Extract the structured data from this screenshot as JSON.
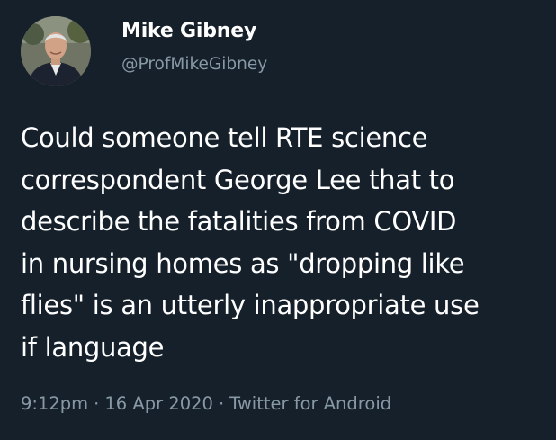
{
  "author": {
    "display_name": "Mike Gibney",
    "handle": "@ProfMikeGibney",
    "avatar_icon": "profile-photo"
  },
  "tweet": {
    "text_lines": [
      "Could someone tell RTE science",
      "correspondent George Lee that to",
      "describe the fatalities from COVID",
      "in nursing homes as \"dropping like",
      "flies\" is an utterly inappropriate use",
      "if language"
    ]
  },
  "meta": {
    "time": "9:12pm",
    "date": "16 Apr 2020",
    "source": "Twitter for Android",
    "separator": "·"
  },
  "colors": {
    "background": "#15202b",
    "primary_text": "#ffffff",
    "secondary_text": "#8899a6"
  }
}
